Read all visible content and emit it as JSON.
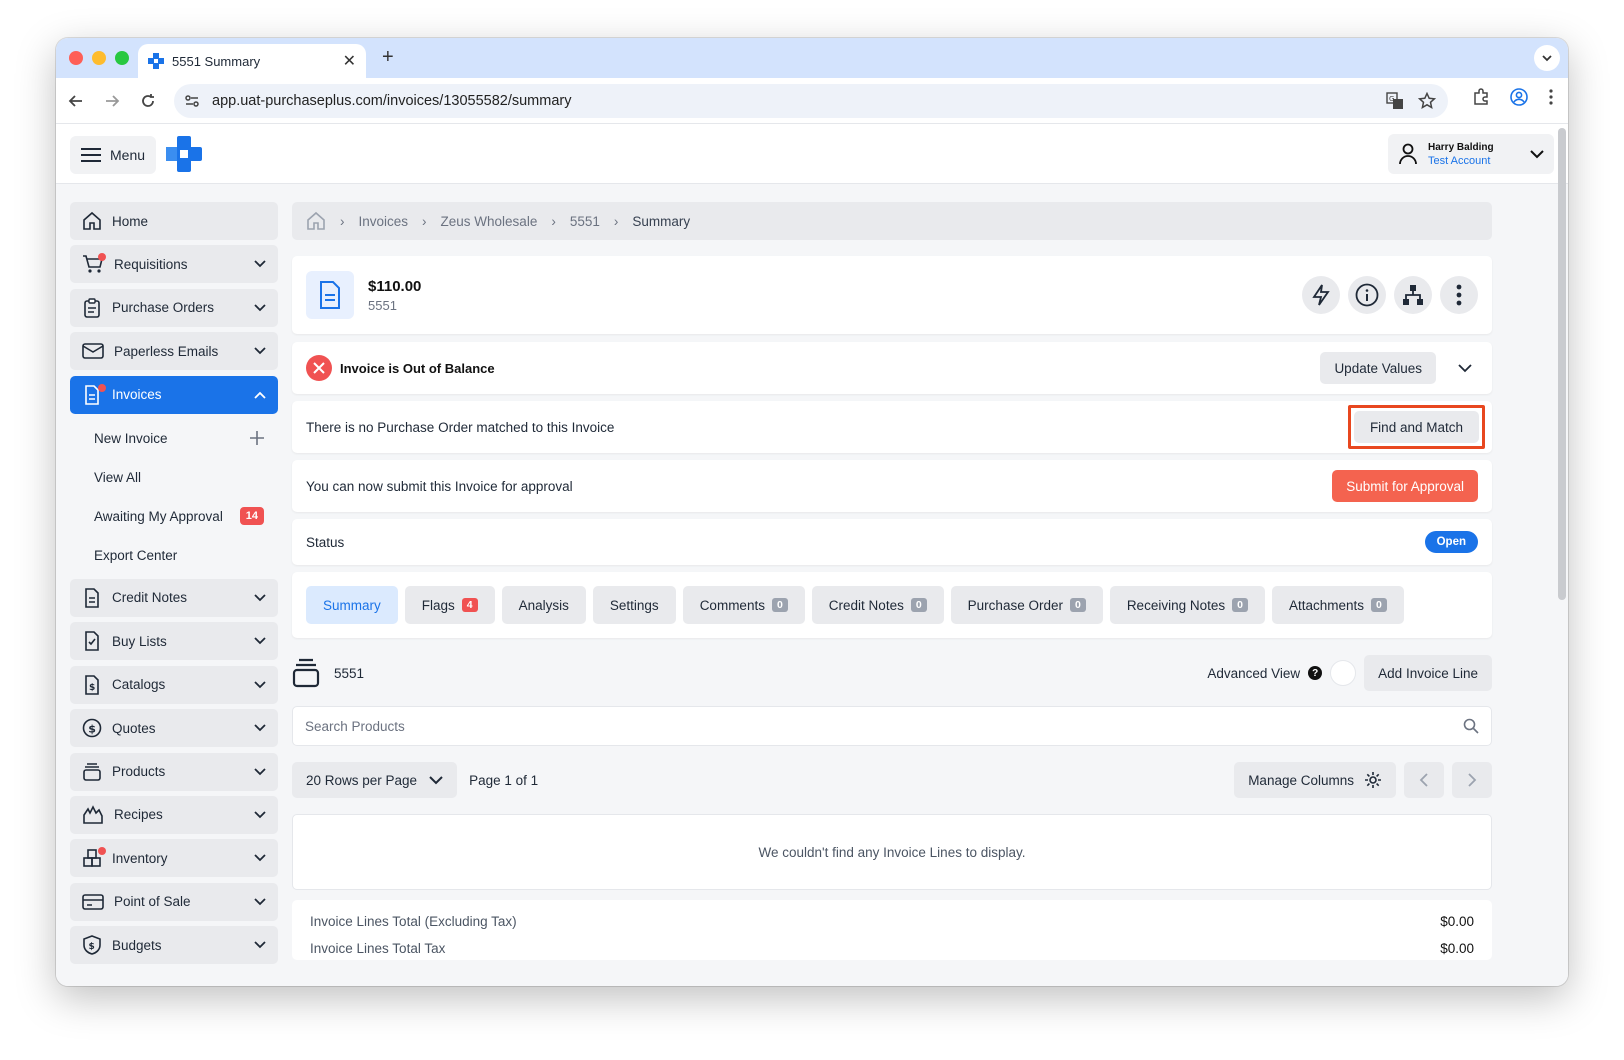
{
  "browser": {
    "tab_title": "5551 Summary",
    "url": "app.uat-purchaseplus.com/invoices/13055582/summary"
  },
  "header": {
    "menu_label": "Menu",
    "user_name": "Harry Balding",
    "user_account": "Test Account"
  },
  "sidebar": {
    "items": [
      {
        "label": "Home",
        "icon": "home-icon"
      },
      {
        "label": "Requisitions",
        "icon": "cart-icon"
      },
      {
        "label": "Purchase Orders",
        "icon": "clipboard-icon"
      },
      {
        "label": "Paperless Emails",
        "icon": "mail-icon"
      },
      {
        "label": "Invoices",
        "icon": "invoice-icon"
      },
      {
        "label": "Credit Notes",
        "icon": "document-icon"
      },
      {
        "label": "Buy Lists",
        "icon": "checklist-icon"
      },
      {
        "label": "Catalogs",
        "icon": "catalog-icon"
      },
      {
        "label": "Quotes",
        "icon": "dollar-circle-icon"
      },
      {
        "label": "Products",
        "icon": "stack-icon"
      },
      {
        "label": "Recipes",
        "icon": "flame-icon"
      },
      {
        "label": "Inventory",
        "icon": "boxes-icon"
      },
      {
        "label": "Point of Sale",
        "icon": "card-icon"
      },
      {
        "label": "Budgets",
        "icon": "shield-dollar-icon"
      }
    ],
    "invoice_sub": {
      "new_invoice": "New Invoice",
      "view_all": "View All",
      "awaiting": "Awaiting My Approval",
      "awaiting_count": "14",
      "export": "Export Center"
    }
  },
  "breadcrumb": {
    "items": [
      "Invoices",
      "Zeus Wholesale",
      "5551",
      "Summary"
    ]
  },
  "invoice": {
    "amount": "$110.00",
    "number": "5551",
    "balance_msg": "Invoice is Out of Balance",
    "update_values": "Update Values",
    "po_msg": "There is no Purchase Order matched to this Invoice",
    "find_match": "Find and Match",
    "submit_msg": "You can now submit this Invoice for approval",
    "submit_btn": "Submit for Approval",
    "status_label": "Status",
    "status_value": "Open"
  },
  "tabs": [
    {
      "label": "Summary",
      "count": null
    },
    {
      "label": "Flags",
      "count": "4"
    },
    {
      "label": "Analysis",
      "count": null
    },
    {
      "label": "Settings",
      "count": null
    },
    {
      "label": "Comments",
      "count": "0"
    },
    {
      "label": "Credit Notes",
      "count": "0"
    },
    {
      "label": "Purchase Order",
      "count": "0"
    },
    {
      "label": "Receiving Notes",
      "count": "0"
    },
    {
      "label": "Attachments",
      "count": "0"
    }
  ],
  "lines": {
    "title": "5551",
    "advanced_view": "Advanced View",
    "add_line": "Add Invoice Line",
    "search_placeholder": "Search Products",
    "rows_per_page": "20 Rows per Page",
    "page_info": "Page 1 of 1",
    "manage_columns": "Manage Columns",
    "empty_msg": "We couldn't find any Invoice Lines to display.",
    "totals": [
      {
        "label": "Invoice Lines Total (Excluding Tax)",
        "value": "$0.00"
      },
      {
        "label": "Invoice Lines Total Tax",
        "value": "$0.00"
      }
    ]
  },
  "colors": {
    "accent": "#1a73e8",
    "danger": "#f05252",
    "submit": "#f4634f",
    "highlight": "#e8471f"
  }
}
